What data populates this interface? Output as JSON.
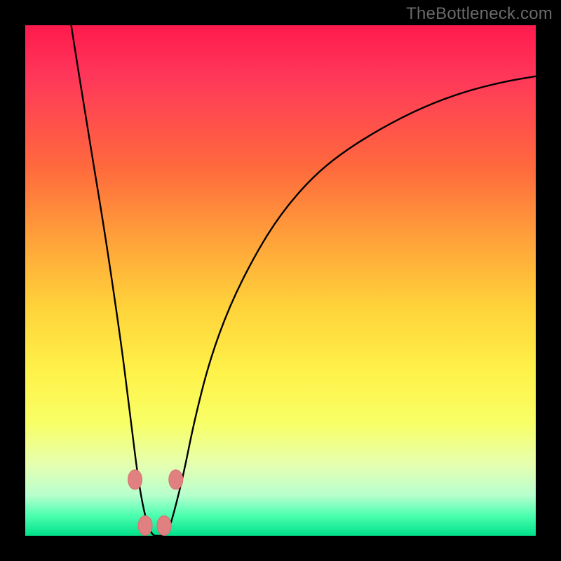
{
  "watermark": "TheBottleneck.com",
  "colors": {
    "curve_stroke": "#000000",
    "marker_fill": "#e08080",
    "marker_stroke": "#d86f6f",
    "background": "#000000",
    "gradient_top": "#ff1a4d",
    "gradient_bottom": "#00e08a"
  },
  "chart_data": {
    "type": "line",
    "title": "",
    "xlabel": "",
    "ylabel": "",
    "xlim": [
      0,
      100
    ],
    "ylim": [
      0,
      100
    ],
    "series": [
      {
        "name": "bottleneck-curve",
        "x": [
          9,
          12,
          15,
          17,
          19,
          20,
          21,
          22,
          23,
          24,
          25,
          26,
          27,
          28,
          29,
          31,
          33,
          36,
          40,
          45,
          50,
          56,
          62,
          70,
          78,
          86,
          94,
          100
        ],
        "y": [
          100,
          81,
          63,
          50,
          36,
          28,
          20,
          12,
          6,
          2,
          0,
          0,
          0,
          1,
          4,
          12,
          22,
          34,
          45,
          55,
          63,
          70,
          75,
          80,
          84,
          87,
          89,
          90
        ]
      }
    ],
    "markers": [
      {
        "x": 21.5,
        "y": 11
      },
      {
        "x": 23.5,
        "y": 2
      },
      {
        "x": 27.2,
        "y": 2
      },
      {
        "x": 29.5,
        "y": 11
      }
    ]
  }
}
